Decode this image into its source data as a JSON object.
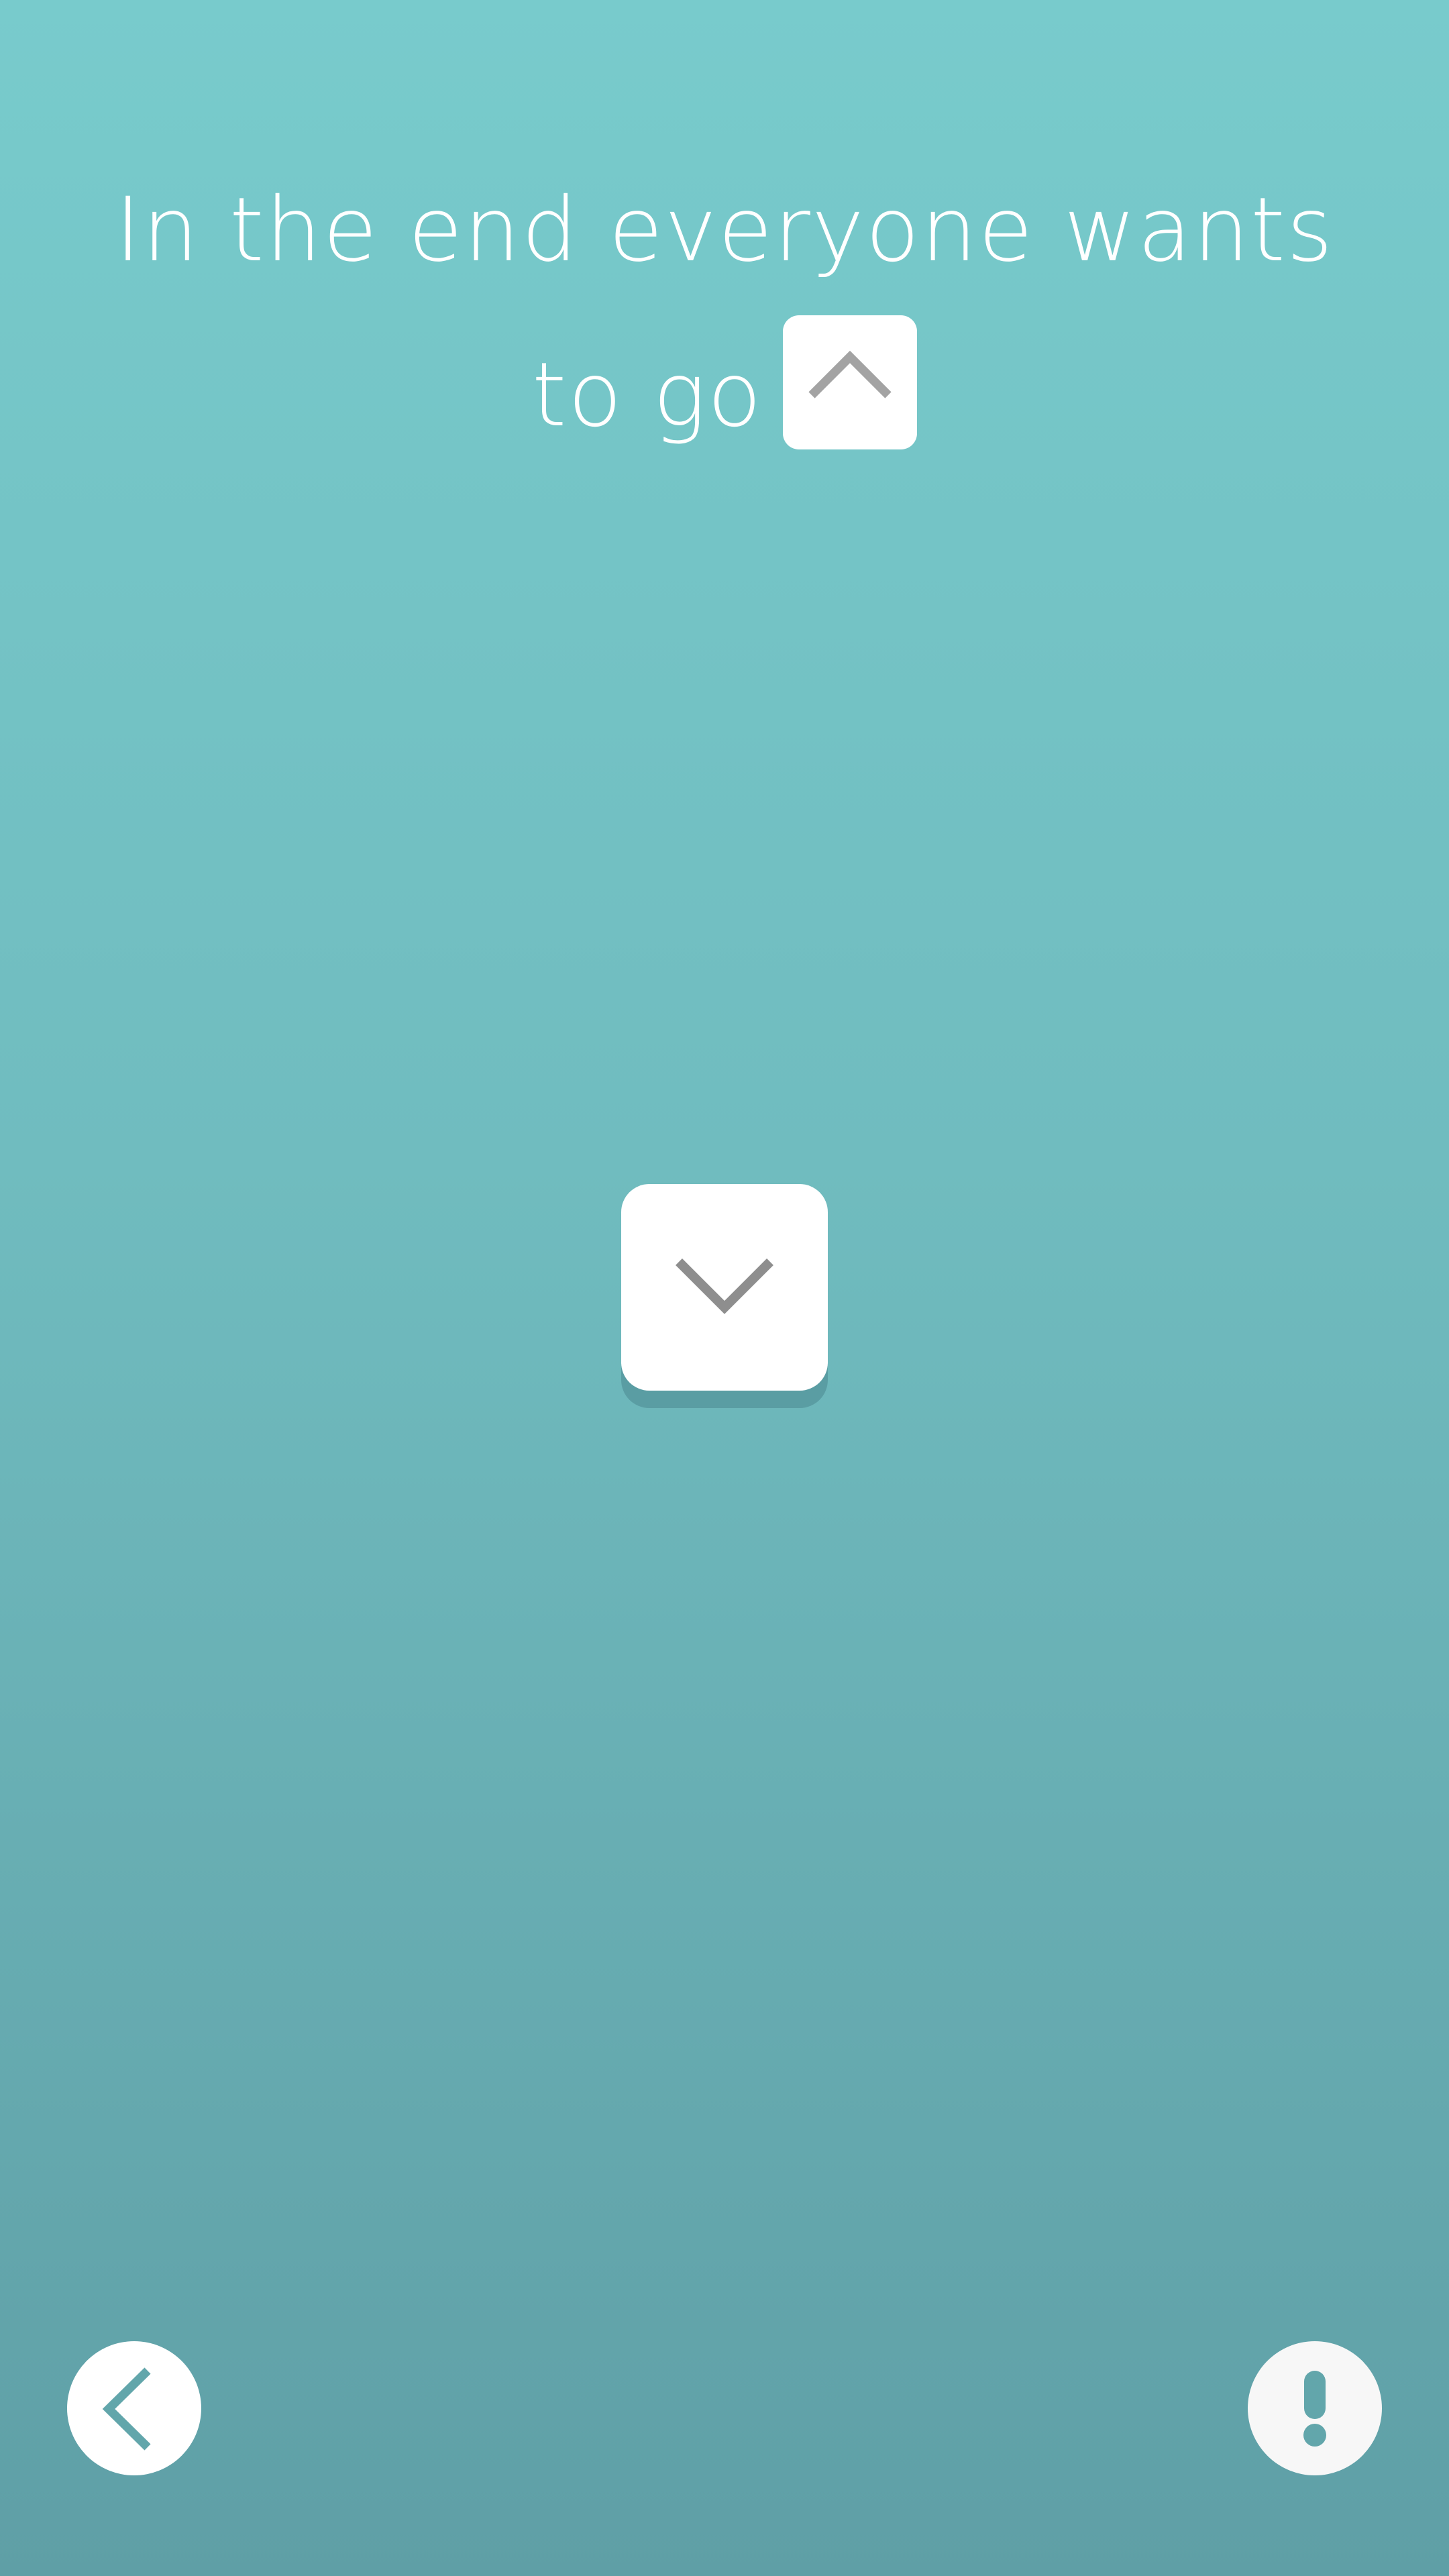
{
  "prompt": {
    "line1": "In the end everyone wants",
    "line2": "to go"
  },
  "icons": {
    "inline_key": "chevron-up-icon",
    "center_key": "chevron-down-icon",
    "back": "chevron-left-icon",
    "hint": "exclamation-icon"
  },
  "colors": {
    "background_top": "#78cbcc",
    "background_bottom": "#5f9fa6",
    "key_face": "#ffffff",
    "key_shadow": "#5a9da3",
    "chevron_gray": "#8e8e8e",
    "accent_teal": "#62a6ab"
  }
}
